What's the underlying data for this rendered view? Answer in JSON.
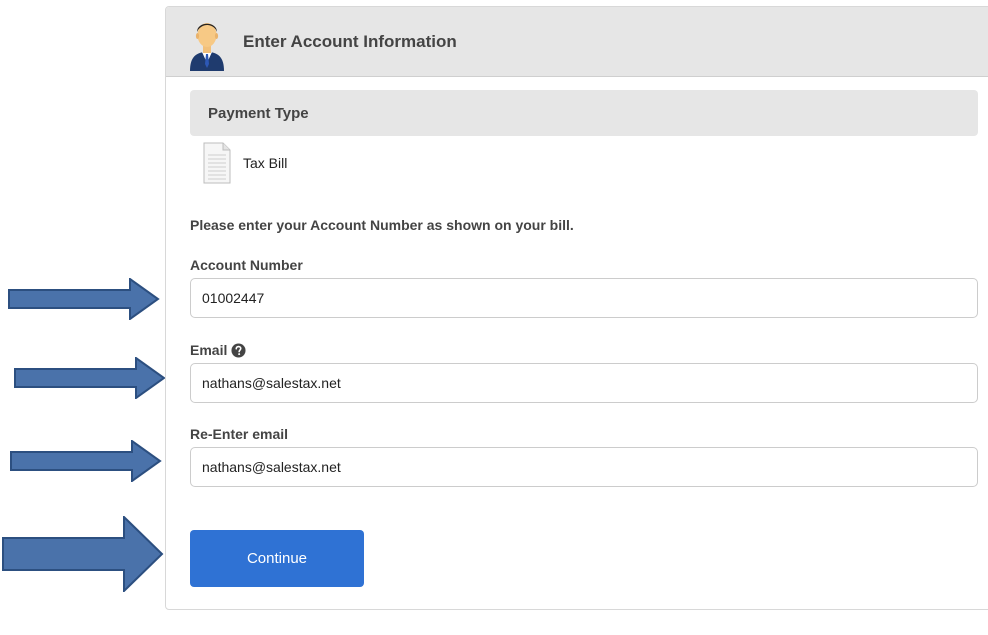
{
  "panel": {
    "title": "Enter Account Information",
    "header_icon": "businessman-avatar-icon"
  },
  "payment_type": {
    "heading": "Payment Type",
    "icon": "document-icon",
    "value": "Tax Bill"
  },
  "form": {
    "instructions": "Please enter your Account Number as shown on your bill.",
    "account_number": {
      "label": "Account Number",
      "value": "01002447"
    },
    "email": {
      "label": "Email",
      "value": "nathans@salestax.net",
      "help_icon": "question-circle-icon"
    },
    "reenter_email": {
      "label": "Re-Enter email",
      "value": "nathans@salestax.net"
    },
    "continue_label": "Continue"
  },
  "colors": {
    "accent": "#2f72d4",
    "arrow_fill": "#4a72aa",
    "arrow_stroke": "#2c4f80",
    "header_bg": "#e6e6e6"
  }
}
